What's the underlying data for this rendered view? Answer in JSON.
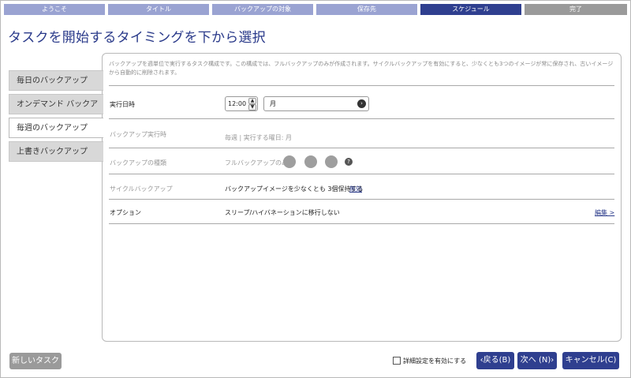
{
  "steps": [
    "ようこそ",
    "タイトル",
    "バックアップの対象",
    "保存先",
    "スケジュール",
    "完了"
  ],
  "page_title": "タスクを開始するタイミングを下から選択",
  "tabs": [
    "毎日のバックアップ",
    "オンデマンド バックアップ",
    "毎週のバックアップ",
    "上書きバックアップ"
  ],
  "description": "バックアップを週単位で実行するタスク構成です。この構成では、フルバックアップのみが作成されます。サイクルバックアップを有効にすると、少なくとも3つのイメージが常に保存され、古いイメージから自動的に削除されます。",
  "rows": {
    "run_time": {
      "label": "実行日時",
      "time": "12:00",
      "day": "月"
    },
    "backup_run": {
      "label": "バックアップ実行時",
      "value": "毎週 | 実行する曜日: 月"
    },
    "backup_type": {
      "label": "バックアップの種類",
      "value": "フルバックアップのみ",
      "help": "?"
    },
    "cycle_backup": {
      "label": "サイクルバックアップ",
      "value": "バックアップイメージを少なくとも 3個保持する",
      "link": "無効"
    },
    "options": {
      "label": "オプション",
      "value": "スリープ/ハイバネーションに移行しない",
      "link": "編集 >"
    }
  },
  "footer": {
    "new_task": "新しいタスク",
    "advanced_checkbox": "詳細設定を有効にする",
    "back": "‹戻る(B)",
    "next": "次へ (N)›",
    "cancel": "キャンセル(C)"
  },
  "colors": {
    "accent": "#2f3f8f",
    "step_inactive": "#9aa3d2",
    "step_done": "#9a9a9a"
  }
}
